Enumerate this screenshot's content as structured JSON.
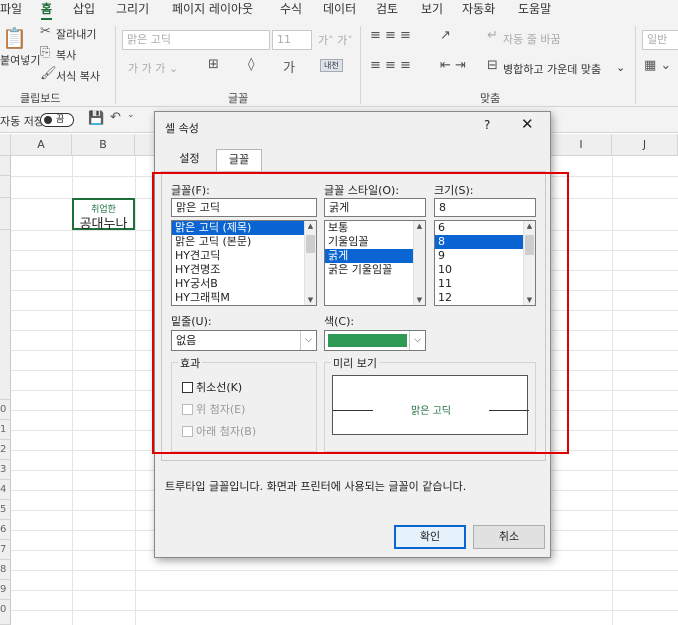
{
  "menu": [
    "파일",
    "홈",
    "삽입",
    "그리기",
    "페이지 레이아웃",
    "수식",
    "데이터",
    "검토",
    "보기",
    "자동화",
    "도움말"
  ],
  "ribbon": {
    "paste_label": "붙여넣기",
    "cut": "잘라내기",
    "copy": "복사",
    "format_painter": "서식 복사",
    "clipboard_group": "클립보드",
    "font_name": "맑은 고딕",
    "font_size": "11",
    "font_group": "글꼴",
    "wrap_text": "자동 줄 바꿈",
    "merge_center": "병합하고 가운데 맞춤",
    "align_group": "맞춤",
    "number_format": "일반"
  },
  "qat": {
    "autosave": "자동 저장",
    "toggle": "끔"
  },
  "sheet": {
    "columns": [
      "A",
      "B",
      "I",
      "J"
    ],
    "row_labels": [
      "0",
      "1",
      "2",
      "3",
      "4",
      "5",
      "6",
      "7",
      "8",
      "9",
      "0"
    ],
    "cell_small": "취업한",
    "cell_big": "공대누나"
  },
  "dialog": {
    "title": "셀 속성",
    "help": "?",
    "close": "✕",
    "tabs": [
      "설정",
      "글꼴"
    ],
    "font_label": "글꼴(F):",
    "font_value": "맑은 고딕",
    "font_list": [
      "맑은 고딕 (제목)",
      "맑은 고딕 (본문)",
      "HY견고딕",
      "HY견명조",
      "HY궁서B",
      "HY그래픽M"
    ],
    "style_label": "글꼴 스타일(O):",
    "style_value": "굵게",
    "style_list": [
      "보통",
      "기울임꼴",
      "굵게",
      "굵은 기울임꼴"
    ],
    "size_label": "크기(S):",
    "size_value": "8",
    "size_list": [
      "6",
      "8",
      "9",
      "10",
      "11",
      "12"
    ],
    "underline_label": "밑줄(U):",
    "underline_value": "없음",
    "color_label": "색(C):",
    "color_value": "#2e9a55",
    "effects_label": "효과",
    "strike": "취소선(K)",
    "superscript": "위 첨자(E)",
    "subscript": "아래 첨자(B)",
    "preview_label": "미리 보기",
    "preview_text": "맑은 고딕",
    "info": "트루타입 글꼴입니다. 화면과 프린터에 사용되는 글꼴이 같습니다.",
    "ok": "확인",
    "cancel": "취소"
  },
  "colors": {
    "accent": "#1e6e3a",
    "selection": "#0a64d2",
    "highlight_box": "#e00000"
  }
}
